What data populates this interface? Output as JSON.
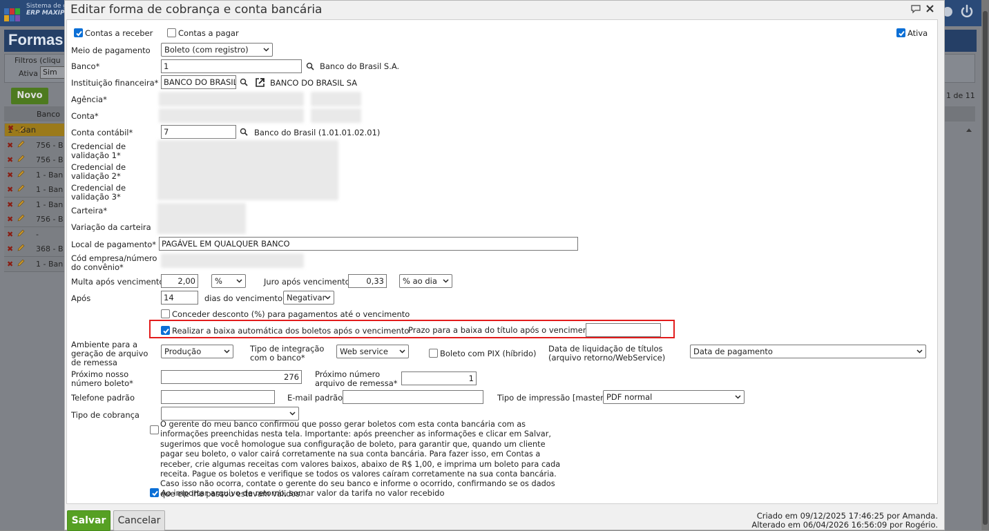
{
  "background_app": {
    "system_label": "Sistema de g",
    "app_name": "ERP MAXIP",
    "page_title": "Formas",
    "filter_label": "Filtros (cliqu",
    "ativa_label": "Ativa",
    "ativa_value": "Sim",
    "new_button": "Novo",
    "grid_header": "Banco",
    "pagination": "1 de 11",
    "rows": [
      "1 - Ban",
      "756 - B",
      "756 - B",
      "1 - Ban",
      "1 - Ban",
      "1 - Ban",
      "756 - B",
      "-",
      "368 - B",
      "1 - Ban"
    ]
  },
  "dialog": {
    "title": "Editar forma de cobrança e conta bancária",
    "contas_receber": "Contas a receber",
    "contas_pagar": "Contas a pagar",
    "ativa": "Ativa",
    "meio_pagamento_label": "Meio de pagamento",
    "meio_pagamento_value": "Boleto (com registro)",
    "banco_label": "Banco*",
    "banco_value": "1",
    "banco_name": "Banco do Brasil S.A.",
    "instituicao_label": "Instituição financeira*",
    "instituicao_value": "BANCO DO BRASIL",
    "instituicao_name": "BANCO DO BRASIL SA",
    "agencia_label": "Agência*",
    "conta_label": "Conta*",
    "conta_contabil_label": "Conta contábil*",
    "conta_contabil_value": "7",
    "conta_contabil_name": "Banco do Brasil (1.01.01.02.01)",
    "credencial1_label": "Credencial de validação 1*",
    "credencial2_label": "Credencial de validação 2*",
    "credencial3_label": "Credencial de validação 3*",
    "carteira_label": "Carteira*",
    "variacao_label": "Variação da carteira",
    "local_pagamento_label": "Local de pagamento*",
    "local_pagamento_value": "PAGÁVEL EM QUALQUER BANCO",
    "cod_empresa_label": "Cód empresa/número do convênio*",
    "multa_label": "Multa após vencimento",
    "multa_value": "2,00",
    "multa_unit": "%",
    "juro_label": "Juro após vencimento",
    "juro_value": "0,33",
    "juro_unit": "% ao dia",
    "apos_label": "Após",
    "apos_value": "14",
    "dias_label": "dias do vencimento",
    "negativar_value": "Negativar",
    "desconto_label": "Conceder desconto (%) para pagamentos até o vencimento",
    "baixa_label": "Realizar a baixa automática dos boletos após o vencimento",
    "prazo_label": "Prazo para a baixa do título após o vencimento",
    "prazo_value": "",
    "ambiente_label": "Ambiente para a geração de arquivo de remessa",
    "ambiente_value": "Produção",
    "tipo_integracao_label": "Tipo de integração com o banco*",
    "tipo_integracao_value": "Web service",
    "boleto_pix_label": "Boleto com PIX (híbrido)",
    "data_liquidacao_label": "Data de liquidação de títulos (arquivo retorno/WebService)",
    "data_liquidacao_value": "Data de pagamento",
    "proximo_boleto_label": "Próximo nosso número boleto*",
    "proximo_boleto_value": "276",
    "proximo_remessa_label": "Próximo número arquivo de remessa*",
    "proximo_remessa_value": "1",
    "telefone_label": "Telefone padrão",
    "telefone_value": "",
    "email_label": "E-mail padrão",
    "email_value": "",
    "tipo_impressao_label": "Tipo de impressão [master]",
    "tipo_impressao_value": "PDF normal",
    "tipo_cobranca_label": "Tipo de cobrança",
    "tipo_cobranca_value": "",
    "gerente_note": "O gerente do meu banco confirmou que posso gerar boletos com esta conta bancária com as informações preenchidas nesta tela. Importante: após preencher as informações e clicar em Salvar, sugerimos que você homologue sua configuração de boleto, para garantir que, quando um cliente pagar seu boleto, o valor cairá corretamente na sua conta bancária. Para fazer isso, em Contas a receber, crie algumas receitas com valores baixos, abaixo de R$ 1,00, e imprima um boleto para cada receita. Pague os boletos e verifique se todos os valores caíram corretamente na sua conta bancária. Caso isso não ocorra, contate o gerente do seu banco e informe o ocorrido, confirmando se os dados que ele lhe passou estavam válidos.",
    "tarifa_label": "Ao importar arquivo de retorno, somar valor da tarifa no valor recebido",
    "save_button": "Salvar",
    "cancel_button": "Cancelar",
    "created": "Criado em 09/12/2025 17:46:25 por Amanda.",
    "altered": "Alterado em 06/04/2026 16:56:09 por Rogério."
  }
}
